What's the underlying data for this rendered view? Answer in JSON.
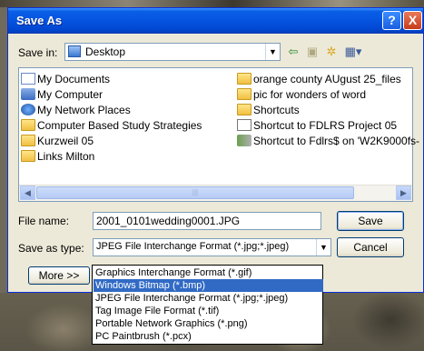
{
  "dialog": {
    "title": "Save As",
    "help_label": "?",
    "close_label": "X"
  },
  "save_in": {
    "label": "Save in:",
    "value": "Desktop"
  },
  "toolbar": {
    "back_icon": "back-arrow-icon",
    "up_icon": "up-folder-icon",
    "new_folder_icon": "new-folder-icon",
    "views_icon": "views-menu-icon"
  },
  "files": {
    "left": [
      {
        "label": "My Documents",
        "icon": "my-documents-icon"
      },
      {
        "label": "My Computer",
        "icon": "my-computer-icon"
      },
      {
        "label": "My Network Places",
        "icon": "network-places-icon"
      },
      {
        "label": "Computer Based Study Strategies",
        "icon": "folder-icon"
      },
      {
        "label": "Kurzweil 05",
        "icon": "folder-icon"
      },
      {
        "label": "Links Milton",
        "icon": "folder-icon"
      }
    ],
    "right": [
      {
        "label": "orange county AUgust 25_files",
        "icon": "folder-icon"
      },
      {
        "label": "pic for wonders of word",
        "icon": "folder-icon"
      },
      {
        "label": "Shortcuts",
        "icon": "folder-icon"
      },
      {
        "label": "Shortcut to FDLRS Project 05",
        "icon": "shortcut-icon"
      },
      {
        "label": "Shortcut to Fdlrs$ on 'W2K9000fs-",
        "icon": "network-shortcut-icon"
      }
    ]
  },
  "file_name": {
    "label": "File name:",
    "value": "2001_0101wedding0001.JPG"
  },
  "save_as_type": {
    "label": "Save as type:",
    "value": "JPEG File Interchange Format (*.jpg;*.jpeg)"
  },
  "buttons": {
    "save": "Save",
    "cancel": "Cancel",
    "more": "More >>"
  },
  "type_options": [
    "Graphics Interchange Format (*.gif)",
    "Windows Bitmap (*.bmp)",
    "JPEG File Interchange Format (*.jpg;*.jpeg)",
    "Tag Image File Format (*.tif)",
    "Portable Network Graphics (*.png)",
    "PC Paintbrush (*.pcx)"
  ],
  "selected_option_index": 1,
  "colors": {
    "titlebar": "#0553e0",
    "dialog_bg": "#ece9d8",
    "selection": "#316ac5"
  }
}
